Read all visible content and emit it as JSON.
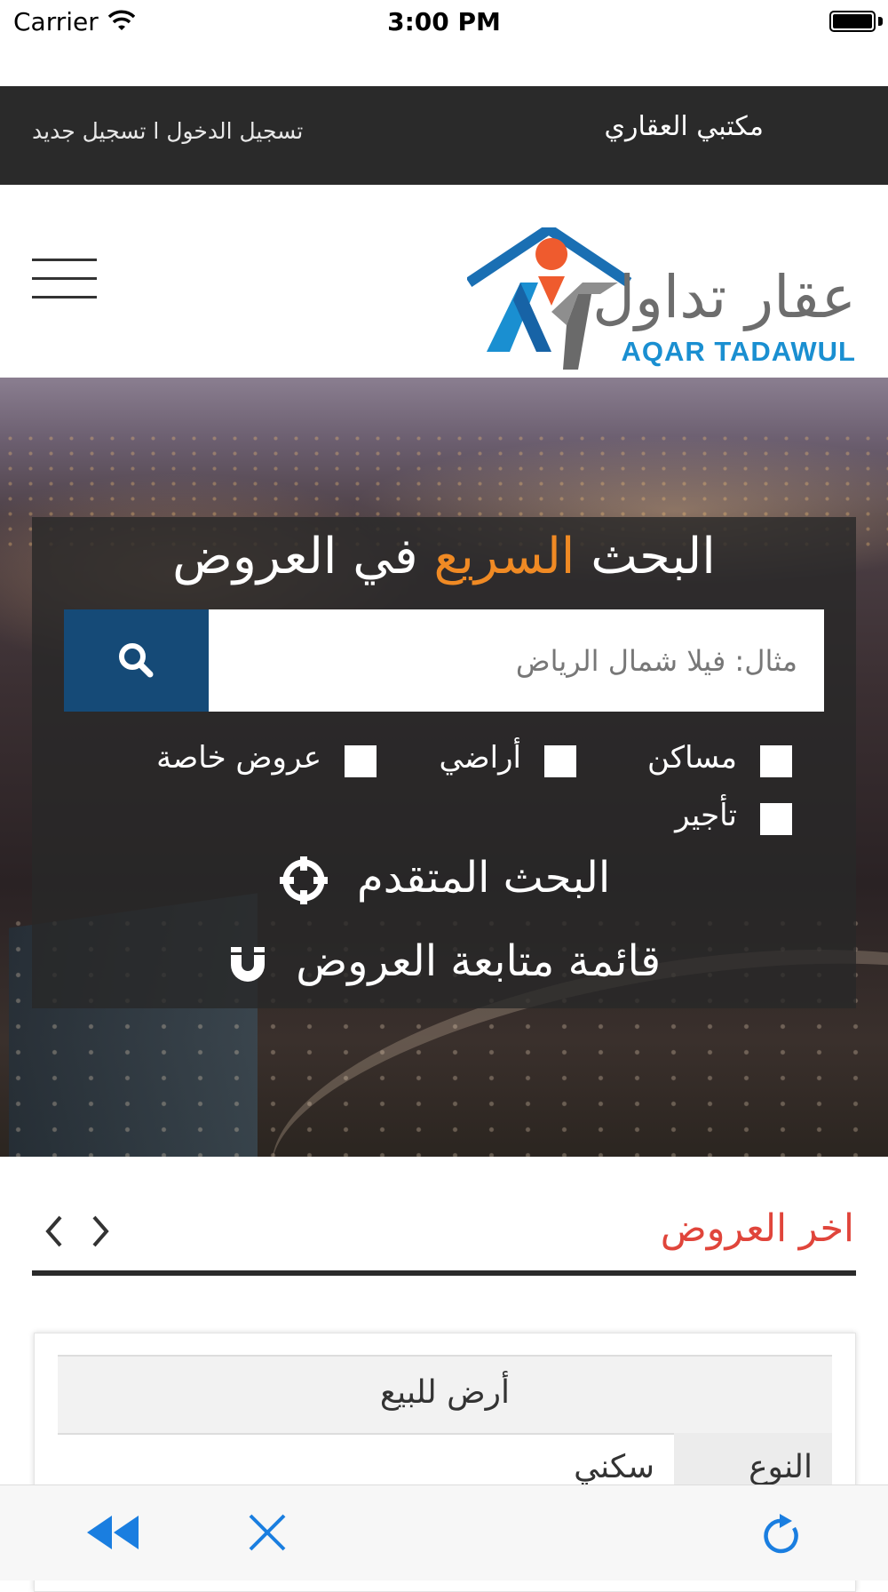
{
  "status_bar": {
    "carrier": "Carrier",
    "time": "3:00 PM"
  },
  "top_bar": {
    "site_title": "مكتبي العقاري",
    "login_label": "تسجيل الدخول",
    "separator": " ا ",
    "register_label": "تسجيل جديد"
  },
  "header": {
    "logo_arabic": "عقار تداول",
    "logo_english": "AQAR TADAWUL"
  },
  "search": {
    "title_part1": "البحث",
    "title_highlight": "السريع",
    "title_part2": "في العروض",
    "placeholder": "مثال: فيلا شمال الرياض",
    "options": [
      "مساكن",
      "أراضي",
      "عروض خاصة",
      "تأجير"
    ],
    "advanced_search": "البحث المتقدم",
    "watchlist": "قائمة متابعة العروض"
  },
  "latest": {
    "title": "اخر العروض",
    "card": {
      "heading": "أرض للبيع",
      "row_key": "النوع",
      "row_value": "سكني"
    }
  },
  "colors": {
    "accent_orange": "#f08a24",
    "accent_red": "#e0453b",
    "search_button": "#154a77",
    "ios_blue": "#1a7ee0"
  }
}
